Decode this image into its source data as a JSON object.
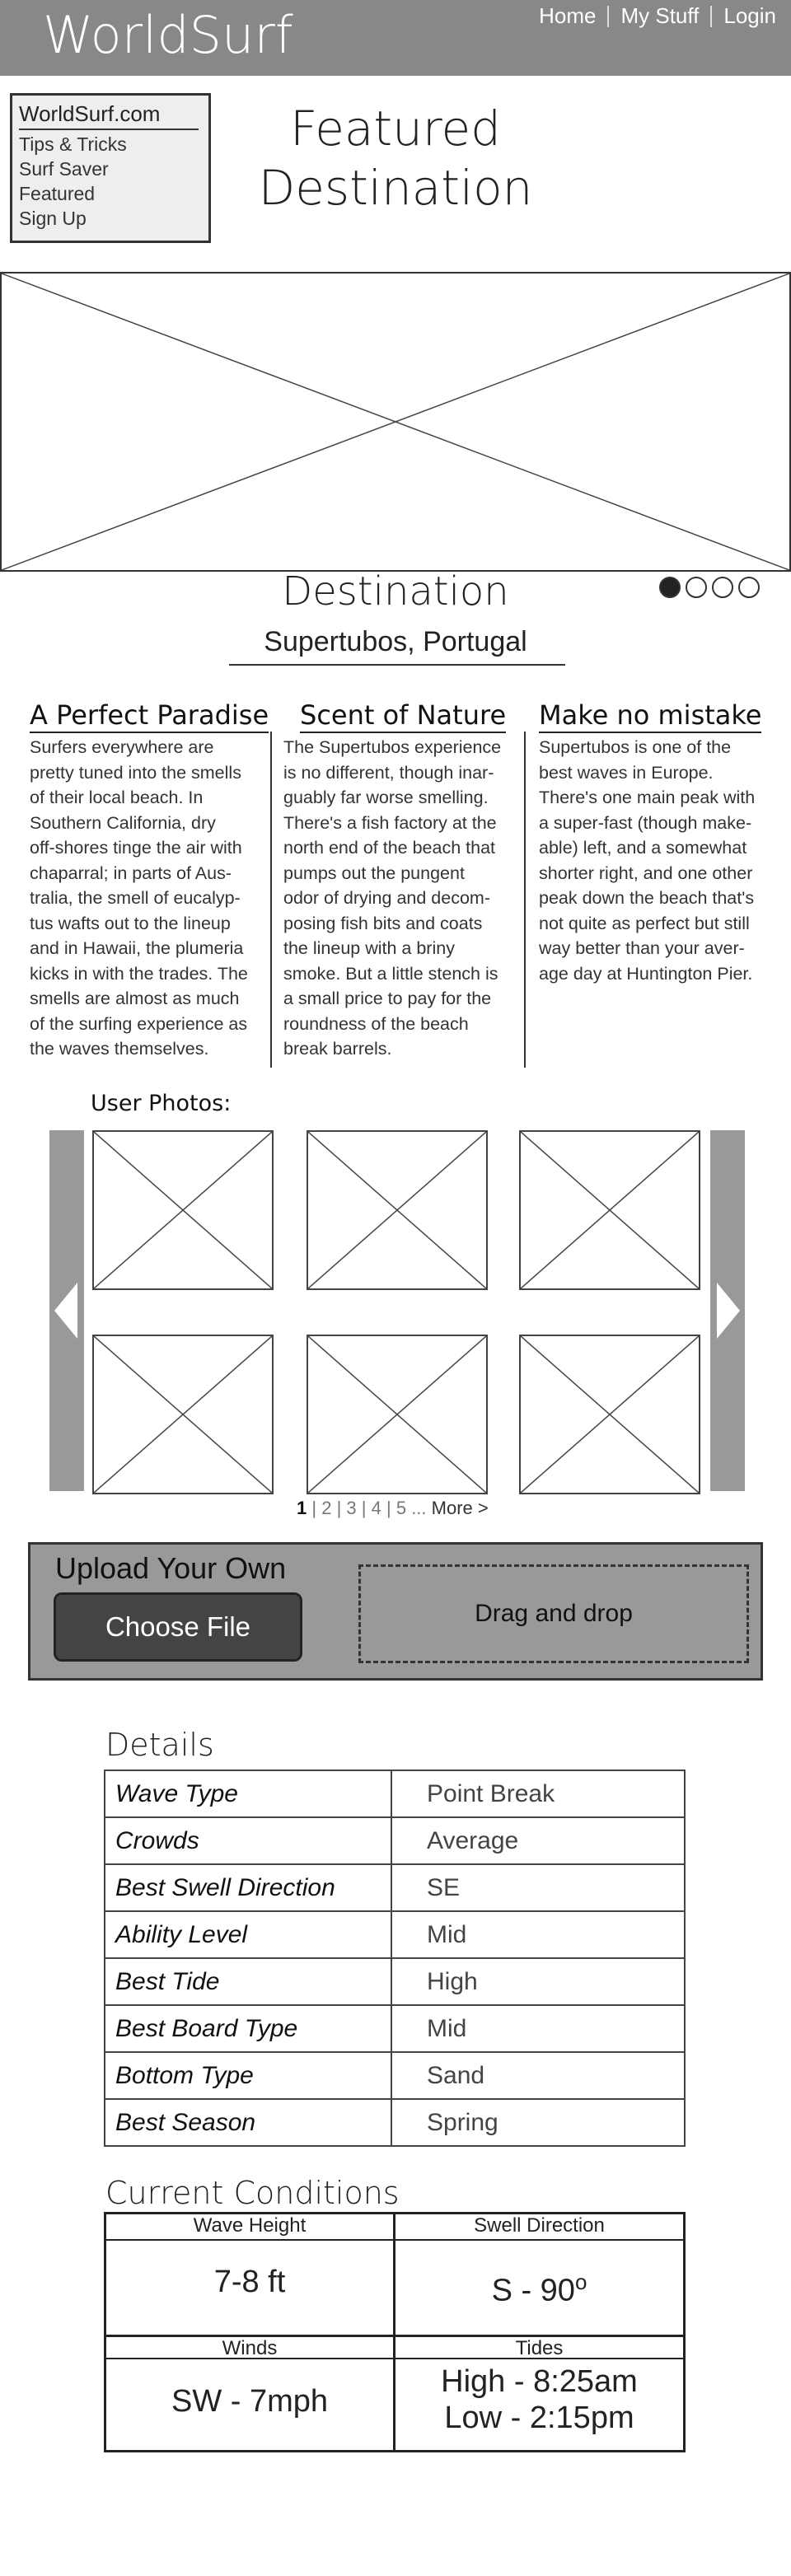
{
  "header": {
    "logo": "WorldSurf",
    "nav": [
      "Home",
      "My Stuff",
      "Login"
    ]
  },
  "side_menu": {
    "site_name": "WorldSurf.com",
    "items": [
      "Tips & Tricks",
      "Surf Saver",
      "Featured",
      "Sign Up"
    ]
  },
  "featured": {
    "title_line1": "Featured",
    "title_line2": "Destination"
  },
  "destination": {
    "label": "Destination",
    "name": "Supertubos, Portugal",
    "carousel_active": 1,
    "carousel_count": 4
  },
  "columns": [
    {
      "title": "A Perfect Paradise",
      "lines": [
        "Surfers everywhere are",
        "pretty tuned into the smells",
        "of their local beach. In",
        "Southern California, dry",
        "off-shores tinge the air with",
        "chaparral; in parts of Aus-",
        "tralia, the smell of eucalyp-",
        "tus wafts out to the lineup",
        "and in Hawaii, the plumeria",
        "kicks in with the trades. The",
        "smells are almost as much",
        "of the surfing experience as",
        "the waves themselves."
      ]
    },
    {
      "title": "Scent of Nature",
      "lines": [
        "The Supertubos experience",
        "is no different, though inar-",
        "guably far worse smelling.",
        "There's a fish factory at the",
        "north end of the beach that",
        "pumps out the pungent",
        "odor of drying and decom-",
        "posing fish bits and coats",
        "the lineup with a briny",
        "smoke. But a little stench is",
        "a small price to pay for the",
        "roundness of the beach",
        "break barrels."
      ]
    },
    {
      "title": "Make no mistake",
      "lines": [
        "Supertubos is one of the",
        "best waves in Europe.",
        "There's one main peak with",
        "a super-fast (though make-",
        "able) left, and a somewhat",
        "shorter right, and one other",
        "peak down the beach that's",
        "not quite as perfect but still",
        "way better than your aver-",
        "age day at Huntington Pier."
      ]
    }
  ],
  "user_photos": {
    "title": "User Photos:",
    "pager": {
      "current": "1",
      "pages": [
        "2",
        "3",
        "4",
        "5"
      ],
      "ellipsis": "...",
      "more": "More >"
    }
  },
  "upload": {
    "title": "Upload Your Own",
    "button": "Choose File",
    "dropzone": "Drag and drop"
  },
  "details": {
    "title": "Details",
    "rows": [
      {
        "key": "Wave Type",
        "value": "Point Break"
      },
      {
        "key": "Crowds",
        "value": "Average"
      },
      {
        "key": "Best Swell Direction",
        "value": "SE"
      },
      {
        "key": "Ability Level",
        "value": "Mid"
      },
      {
        "key": "Best Tide",
        "value": "High"
      },
      {
        "key": "Best Board Type",
        "value": "Mid"
      },
      {
        "key": "Bottom Type",
        "value": "Sand"
      },
      {
        "key": "Best Season",
        "value": "Spring"
      }
    ]
  },
  "conditions": {
    "title": "Current Conditions",
    "wave_height": {
      "label": "Wave Height",
      "value": "7-8 ft"
    },
    "swell_direction": {
      "label": "Swell Direction",
      "value": "S - 90",
      "unit": "o"
    },
    "winds": {
      "label": "Winds",
      "value": "SW - 7mph"
    },
    "tides": {
      "label": "Tides",
      "high": "High - 8:25am",
      "low": "Low - 2:15pm"
    }
  },
  "colors": {
    "header_bg": "#888888",
    "panel_bg": "#999999",
    "button_bg": "#444444"
  }
}
